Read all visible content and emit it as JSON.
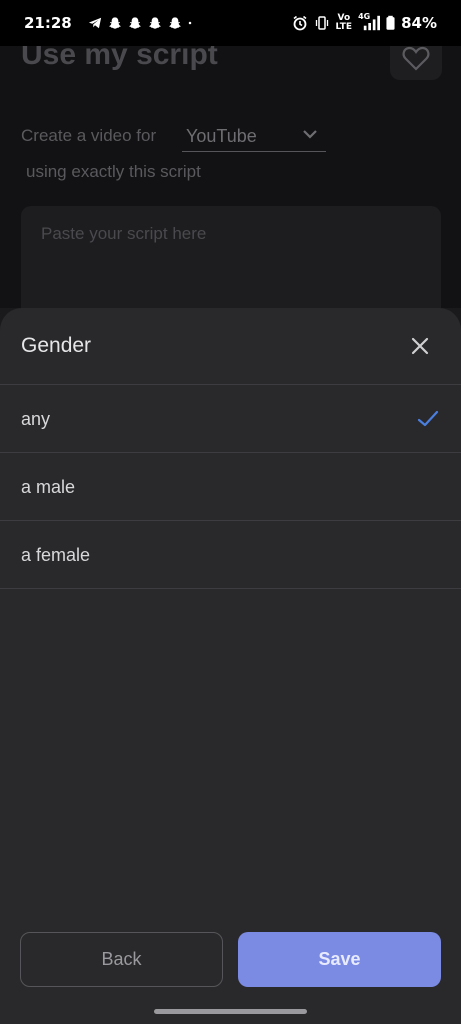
{
  "status_bar": {
    "time": "21:28",
    "left_icons": [
      "telegram-icon",
      "snapchat-icon",
      "snapchat-icon",
      "snapchat-icon",
      "snapchat-icon",
      "dot-icon"
    ],
    "right_icons": [
      "alarm-icon",
      "vibrate-icon",
      "volte-icon",
      "4g-signal-icon",
      "battery-icon"
    ],
    "volte_top": "Vo",
    "volte_bottom": "LTE",
    "network": "4G",
    "battery": "84%"
  },
  "background": {
    "title": "Use my script",
    "create_prefix": "Create a video for",
    "platform_value": "YouTube",
    "create_suffix": "using exactly this script",
    "script_placeholder": "Paste your script here"
  },
  "sheet": {
    "title": "Gender",
    "options": [
      {
        "label": "any",
        "selected": true
      },
      {
        "label": "a male",
        "selected": false
      },
      {
        "label": "a female",
        "selected": false
      }
    ],
    "back_label": "Back",
    "save_label": "Save"
  },
  "colors": {
    "accent": "#7b8be4",
    "check": "#4a7fe0",
    "sheet_bg": "#29292c"
  }
}
